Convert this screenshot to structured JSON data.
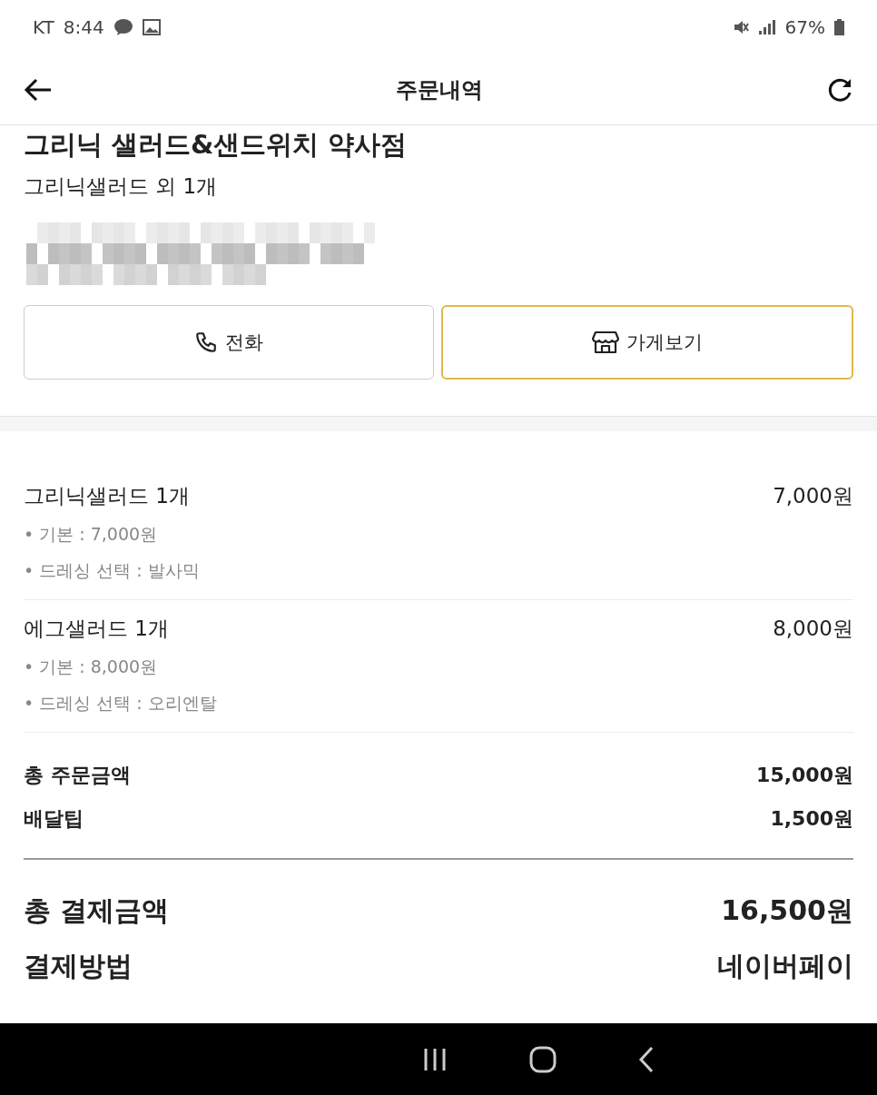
{
  "status_bar": {
    "carrier": "KT",
    "time": "8:44",
    "battery": "67%"
  },
  "header": {
    "title": "주문내역"
  },
  "store": {
    "name": "그리닉 샐러드&샌드위치 약사점",
    "summary": "그리닉샐러드 외 1개"
  },
  "buttons": [
    {
      "label": "전화",
      "kind": "phone",
      "highlighted": false
    },
    {
      "label": "가게보기",
      "kind": "store",
      "highlighted": true
    }
  ],
  "items": [
    {
      "name": "그리닉샐러드 1개",
      "price": "7,000원",
      "options": [
        "• 기본 : 7,000원",
        "• 드레싱 선택 : 발사믹"
      ]
    },
    {
      "name": "에그샐러드 1개",
      "price": "8,000원",
      "options": [
        "• 기본 : 8,000원",
        "• 드레싱 선택 : 오리엔탈"
      ]
    }
  ],
  "subtotals": [
    {
      "label": "총 주문금액",
      "value": "15,000원"
    },
    {
      "label": "배달팁",
      "value": "1,500원"
    }
  ],
  "totals": [
    {
      "label": "총 결제금액",
      "value": "16,500원"
    },
    {
      "label": "결제방법",
      "value": "네이버페이"
    }
  ]
}
